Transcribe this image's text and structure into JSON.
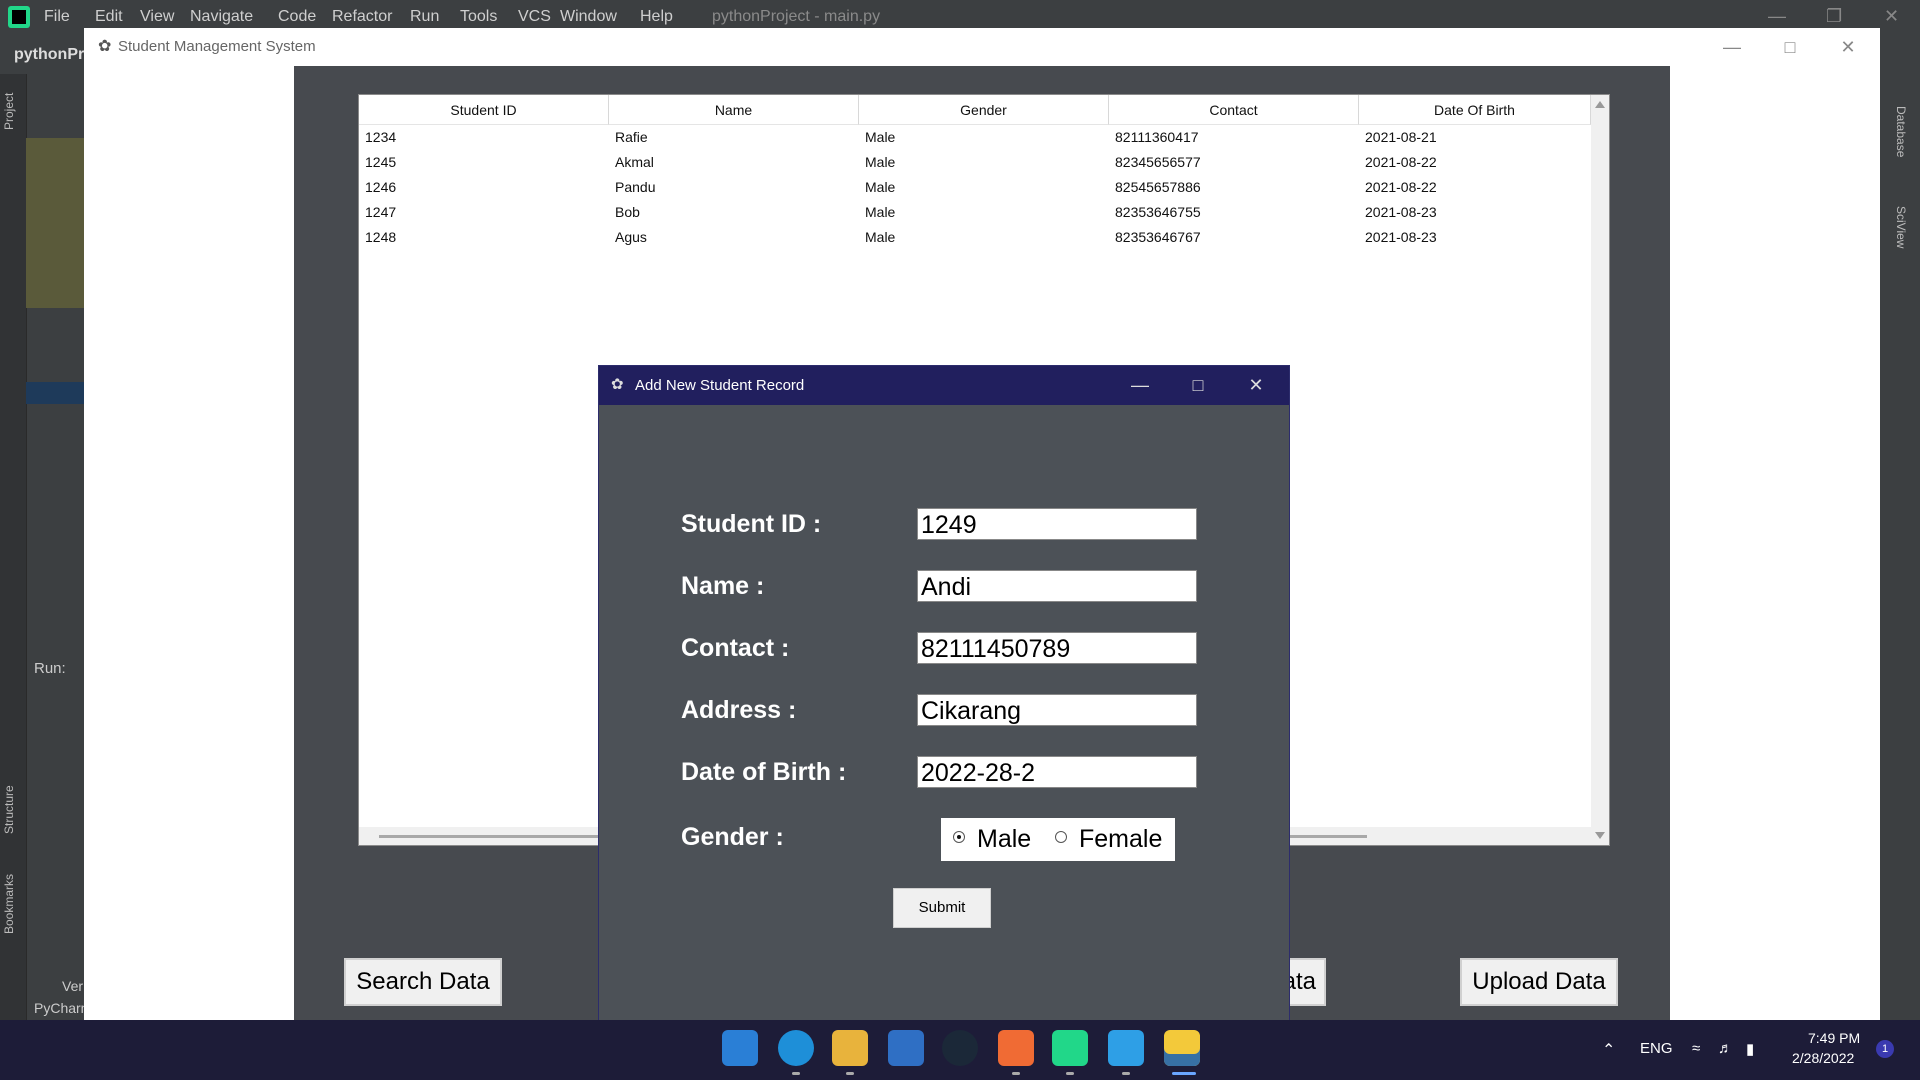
{
  "ide": {
    "menu": [
      "File",
      "Edit",
      "View",
      "Navigate",
      "Code",
      "Refactor",
      "Run",
      "Tools",
      "VCS",
      "Window",
      "Help"
    ],
    "title": "pythonProject - main.py",
    "project_name": "pythonPr",
    "left_labels": [
      "Project",
      "Structure",
      "Bookmarks"
    ],
    "right_labels": [
      "Database",
      "SciView"
    ],
    "run_label": "Run:",
    "bottom_labels": [
      "Ver",
      "PyCharm"
    ]
  },
  "main_window": {
    "title": "Student Management System",
    "table": {
      "columns": [
        "Student ID",
        "Name",
        "Gender",
        "Contact",
        "Date Of Birth"
      ],
      "rows": [
        [
          "1234",
          "Rafie",
          "Male",
          "82111360417",
          "2021-08-21"
        ],
        [
          "1245",
          "Akmal",
          "Male",
          "82345656577",
          "2021-08-22"
        ],
        [
          "1246",
          "Pandu",
          "Male",
          "82545657886",
          "2021-08-22"
        ],
        [
          "1247",
          "Bob",
          "Male",
          "82353646755",
          "2021-08-23"
        ],
        [
          "1248",
          "Agus",
          "Male",
          "82353646767",
          "2021-08-23"
        ]
      ]
    },
    "buttons": {
      "search": "Search Data",
      "partial": "ata",
      "upload": "Upload Data"
    }
  },
  "dialog": {
    "title": "Add New Student Record",
    "fields": {
      "student_id": {
        "label": "Student ID :",
        "value": "1249"
      },
      "name": {
        "label": "Name :",
        "value": "Andi"
      },
      "contact": {
        "label": "Contact :",
        "value": "82111450789"
      },
      "address": {
        "label": "Address :",
        "value": "Cikarang"
      },
      "dob": {
        "label": "Date of Birth :",
        "value": "2022-28-2"
      }
    },
    "gender": {
      "label": "Gender :",
      "options": [
        "Male",
        "Female"
      ],
      "selected": "Male"
    },
    "submit_label": "Submit"
  },
  "taskbar": {
    "apps": [
      "windows-start",
      "edge",
      "file-explorer",
      "mail",
      "steam",
      "xampp",
      "pycharm",
      "vscode",
      "python"
    ],
    "language": "ENG",
    "time": "7:49 PM",
    "date": "2/28/2022",
    "notification_count": "1"
  }
}
